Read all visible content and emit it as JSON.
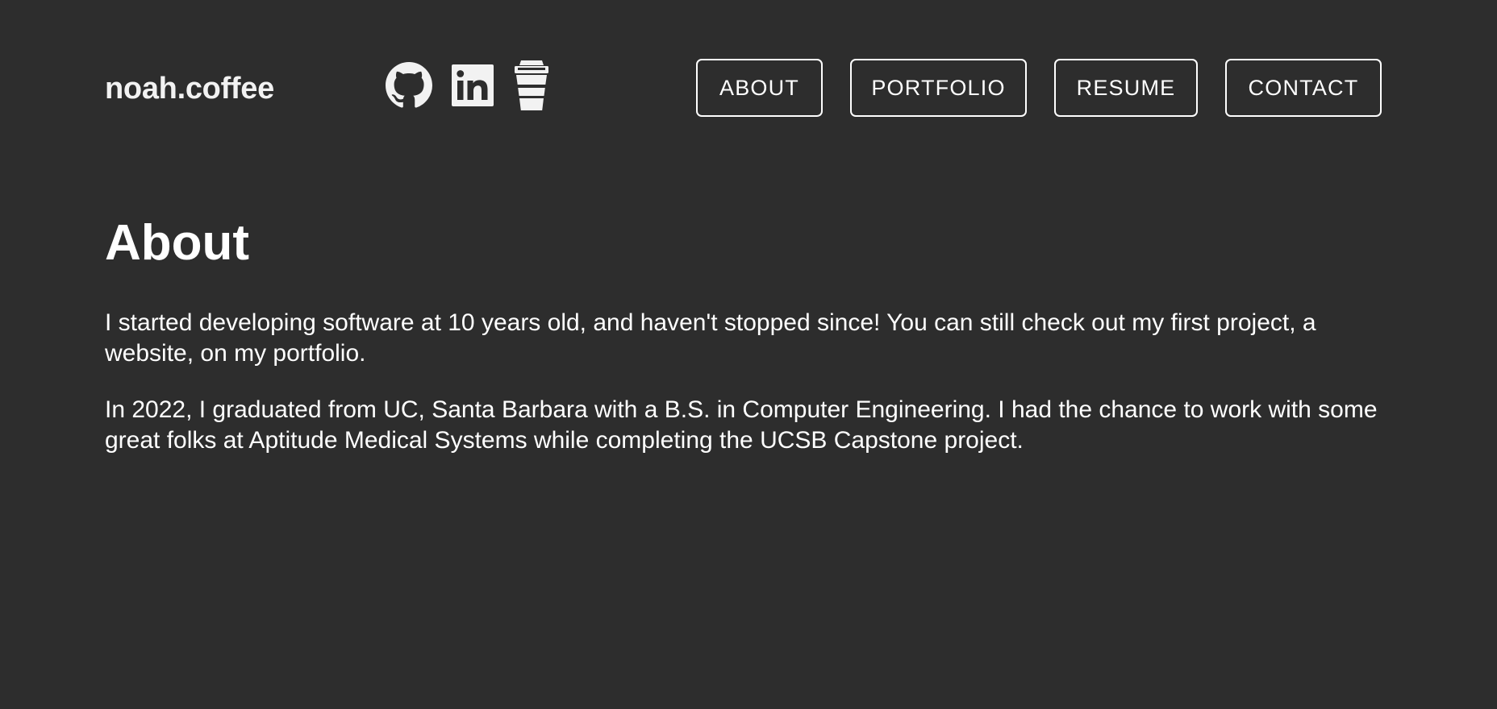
{
  "header": {
    "logo_text": "noah.coffee",
    "social": [
      {
        "icon": "github-icon"
      },
      {
        "icon": "linkedin-icon"
      },
      {
        "icon": "coffee-cup-icon"
      }
    ],
    "nav": {
      "about": "ABOUT",
      "portfolio": "PORTFOLIO",
      "resume": "RESUME",
      "contact": "CONTACT"
    }
  },
  "main": {
    "title": "About",
    "paragraphs": [
      "I started developing software at 10 years old, and haven't stopped since! You can still check out my first project, a website, on my portfolio.",
      "In 2022, I graduated from UC, Santa Barbara with a B.S. in Computer Engineering. I had the chance to work with some great folks at Aptitude Medical Systems while completing the UCSB Capstone project."
    ]
  },
  "colors": {
    "background": "#2d2d2d",
    "text": "#ffffff",
    "accent_border": "#ffffff"
  }
}
